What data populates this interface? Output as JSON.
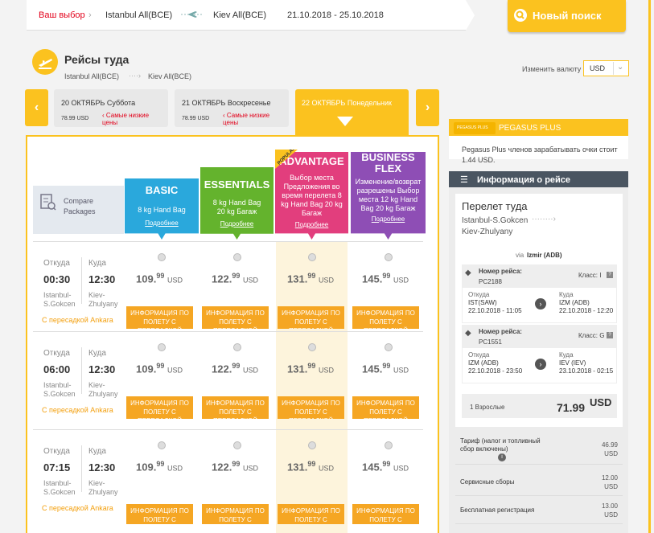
{
  "topbar": {
    "choice": "Ваш выбор",
    "from": "Istanbul All(BCE)",
    "to": "Kiev All(BCE)",
    "dates": "21.10.2018 - 25.10.2018",
    "search": "Новый поиск"
  },
  "header": {
    "title": "Рейсы туда",
    "from": "Istanbul All(BCE)",
    "to": "Kiev All(BCE)",
    "currency_label": "Изменить валюту",
    "currency": "USD"
  },
  "dates": [
    {
      "label": "20 ОКТЯБРЬ Суббота",
      "price": "78.99 USD",
      "note": "Самые низкие цены"
    },
    {
      "label": "21 ОКТЯБРЬ Воскресенье",
      "price": "78.99 USD",
      "note": "Самые низкие цены"
    },
    {
      "label": "22 ОКТЯБРЬ Понедельник"
    }
  ],
  "compare": "Compare Packages",
  "packages": [
    {
      "name": "BASIC",
      "desc": "8 kg Hand Bag",
      "link": "Подробнее",
      "color": "#2aa8dc"
    },
    {
      "name": "ESSENTIALS",
      "desc": "8 kg Hand Bag\n20 kg Багаж",
      "link": "Подробнее",
      "color": "#64b32d"
    },
    {
      "name": "ADVANTAGE",
      "badge": "POPULAR",
      "desc": "Выбор места Предложения во время перелета 8 kg Hand Bag 20 kg Багаж",
      "link": "Подробнее",
      "color": "#e23e7d"
    },
    {
      "name": "BUSINESS FLEX",
      "desc": "Изменение/возврат разрешены Выбор места 12 kg Hand Bag 20 kg Багаж",
      "link": "Подробнее",
      "color": "#8e4eb5"
    }
  ],
  "labels": {
    "from": "Откуда",
    "to": "Куда",
    "info": "ИНФОРМАЦИЯ ПО ПОЛЕТУ С ПЕРЕСАДКОЙ"
  },
  "flights": [
    {
      "dep": "00:30",
      "arr": "12:30",
      "dep_city": "Istanbul-S.Gokcen",
      "arr_city": "Kiev-Zhulyany",
      "via": "С пересадкой Ankara",
      "prices": [
        {
          "i": "109",
          "d": "99"
        },
        {
          "i": "122",
          "d": "99"
        },
        {
          "i": "131",
          "d": "99"
        },
        {
          "i": "145",
          "d": "99"
        }
      ]
    },
    {
      "dep": "06:00",
      "arr": "12:30",
      "dep_city": "Istanbul-S.Gokcen",
      "arr_city": "Kiev-Zhulyany",
      "via": "С пересадкой Ankara",
      "prices": [
        {
          "i": "109",
          "d": "99"
        },
        {
          "i": "122",
          "d": "99"
        },
        {
          "i": "131",
          "d": "99"
        },
        {
          "i": "145",
          "d": "99"
        }
      ]
    },
    {
      "dep": "07:15",
      "arr": "12:30",
      "dep_city": "Istanbul-S.Gokcen",
      "arr_city": "Kiev-Zhulyany",
      "via": "С пересадкой Ankara",
      "prices": [
        {
          "i": "109",
          "d": "99"
        },
        {
          "i": "122",
          "d": "99"
        },
        {
          "i": "131",
          "d": "99"
        },
        {
          "i": "145",
          "d": "99"
        }
      ]
    }
  ],
  "usd": "USD",
  "right": {
    "pp_title": "PEGASUS PLUS",
    "pp_logo": "PEGASUS PLUS",
    "pp_text": "Pegasus Plus членов зарабатывать очки стоит 1.44 USD.",
    "info_title": "Информация о рейсе",
    "leg_title": "Перелет туда",
    "leg_from": "Istanbul-S.Gokcen",
    "leg_to": "Kiev-Zhulyany",
    "via_label": "via",
    "via": "Izmir (ADB)",
    "segments": [
      {
        "flight_label": "Номер рейса:",
        "flight": "PC2188",
        "class": "Класс: I",
        "from": "IST(SAW)",
        "from_time": "22.10.2018 - 11:05",
        "to": "IZM (ADB)",
        "to_time": "22.10.2018 - 12:20"
      },
      {
        "flight_label": "Номер рейса:",
        "flight": "PC1551",
        "class": "Класс: G",
        "from": "IZM (ADB)",
        "from_time": "22.10.2018 - 23:50",
        "to": "IEV (IEV)",
        "to_time": "23.10.2018 - 02:15"
      }
    ],
    "pax": "1 Взрослые",
    "total": "71.99",
    "cur": "USD",
    "fees": [
      {
        "label": "Тариф (налог и топливный сбор включены)",
        "value": "46.99 USD"
      },
      {
        "label": "Сервисные сборы",
        "value": "12.00 USD"
      },
      {
        "label": "Бесплатная регистрация",
        "value": "13.00 USD"
      }
    ]
  }
}
